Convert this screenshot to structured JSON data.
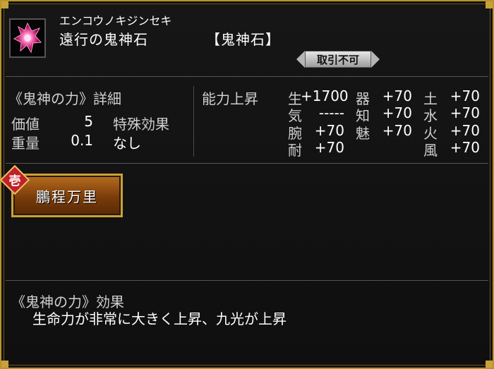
{
  "item": {
    "kana": "エンコウノキジンセキ",
    "name": "遠行の鬼神石",
    "category": "【鬼神石】",
    "trade": "取引不可",
    "icon": "crystal-icon"
  },
  "details": {
    "header": "《鬼神の力》詳細",
    "value_label": "価値",
    "value": "5",
    "weight_label": "重量",
    "weight": "0.1",
    "special_label": "特殊効果",
    "special_value": "なし"
  },
  "ability": {
    "header": "能力上昇",
    "stats": [
      {
        "label": "生",
        "value": "+1700"
      },
      {
        "label": "気",
        "value": "-----"
      },
      {
        "label": "腕",
        "value": "+70"
      },
      {
        "label": "耐",
        "value": "+70"
      },
      {
        "label": "器",
        "value": "+70"
      },
      {
        "label": "知",
        "value": "+70"
      },
      {
        "label": "魅",
        "value": "+70"
      },
      {
        "label": "土",
        "value": "+70"
      },
      {
        "label": "水",
        "value": "+70"
      },
      {
        "label": "火",
        "value": "+70"
      },
      {
        "label": "風",
        "value": "+70"
      }
    ]
  },
  "skill": {
    "badge": "壱",
    "name": "鵬程万里"
  },
  "effect": {
    "header": "《鬼神の力》効果",
    "text": "生命力が非常に大きく上昇、九光が上昇"
  },
  "colors": {
    "frame_gold": "#b8932e",
    "button_orange": "#a05a18",
    "badge_red": "#c0202a",
    "crystal_pink": "#ff5aa8"
  }
}
